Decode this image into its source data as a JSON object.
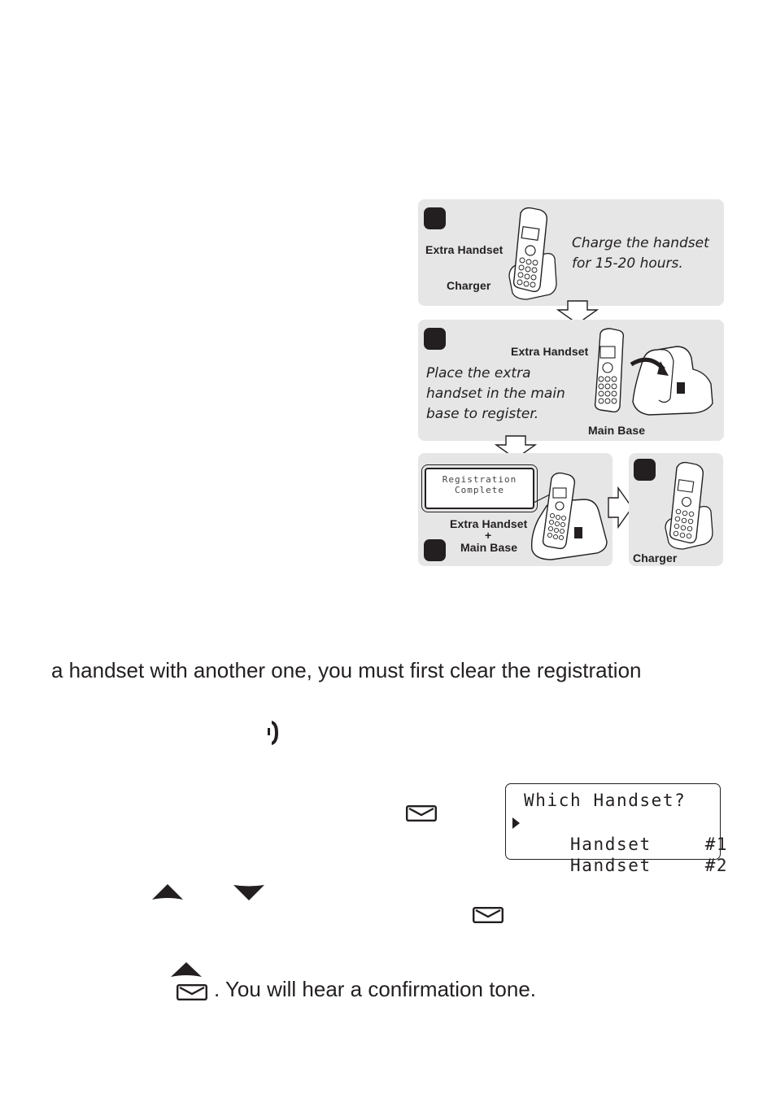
{
  "diagram": {
    "step1": {
      "handset_label": "Extra Handset",
      "charger_label": "Charger",
      "instruction_line1": "Charge the handset",
      "instruction_line2": "for 15-20 hours."
    },
    "step2": {
      "handset_label": "Extra Handset",
      "base_label": "Main Base",
      "instruction_line1": "Place the extra",
      "instruction_line2": "handset in the main",
      "instruction_line3": "base to register."
    },
    "step3": {
      "display_line1": "Registration",
      "display_line2": "Complete",
      "label_line1": "Extra Handset",
      "label_plus": "+",
      "label_line2": "Main Base"
    },
    "step4": {
      "charger_label": "Charger"
    }
  },
  "body": {
    "paragraph_line": "a handset with another one, you must first clear the registration",
    "confirmation_text": ". You will hear a confirmation tone."
  },
  "lcd": {
    "title": "Which Handset?",
    "options": [
      {
        "label": "Handset",
        "number": "#1",
        "selected": true
      },
      {
        "label": "Handset",
        "number": "#2",
        "selected": false
      }
    ]
  },
  "icons": {
    "talk": "talk-phone-icon",
    "select": "envelope-select-icon",
    "up": "up-triangle-icon",
    "down": "down-triangle-icon"
  },
  "colors": {
    "panel": "#e6e6e6",
    "ink": "#231f20"
  }
}
